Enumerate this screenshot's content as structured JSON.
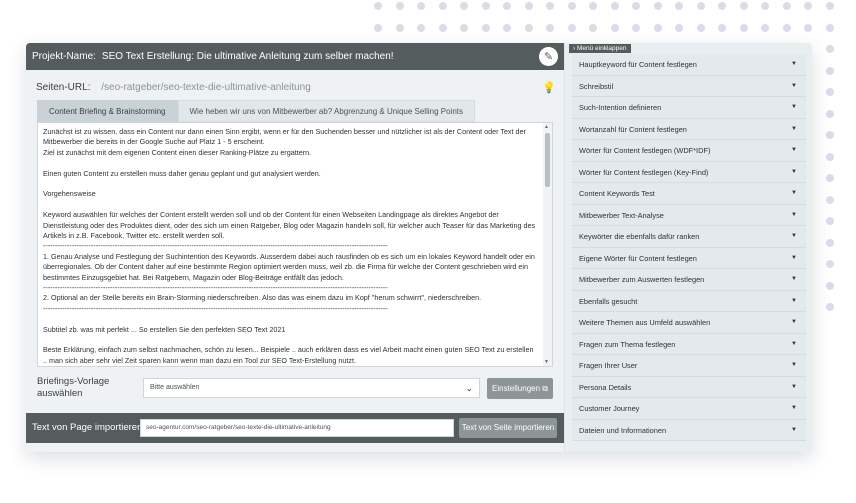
{
  "project": {
    "label": "Projekt-Name:",
    "name": "SEO Text Erstellung: Die ultimative Anleitung zum selber machen!",
    "edit_icon": "pencil-icon"
  },
  "url": {
    "label": "Seiten-URL:",
    "value": "/seo-ratgeber/seo-texte-die-ultimative-anleitung",
    "hint_icon": "lightbulb-icon"
  },
  "tabs": [
    {
      "label": "Content Briefing & Brainstorming",
      "active": true
    },
    {
      "label": "Wie heben wir uns von Mitbewerber ab? Abgrenzung & Unique Selling Points",
      "active": false
    }
  ],
  "editor": {
    "paragraphs": [
      "Zunächst ist zu wissen, dass ein Content nur dann einen Sinn ergibt, wenn er für den Suchenden besser und nützlicher ist  als der Content oder Text der Mitbewerber die bereits in der Google Suche auf Platz 1 - 5 erscheint.",
      "Ziel ist zunächst mit dem eigenen Content einen dieser Ranking-Plätze zu ergattern.",
      "Einen guten Content zu erstellen muss daher genau geplant und gut analysiert werden.",
      "Vorgehensweise",
      "Keyword auswählen für welches der Content erstellt werden soll und ob der Content für einen Webseiten Landingpage als direktes Angebot der Dienstleistung oder des Produktes dient, oder des sich um einen Ratgeber, Blog oder Magazin handeln soll,  für welcher auch Teaser für das Marketing des Artikels in z.B. Facebook, Twitter etc. erstellt werden soll.",
      "------------------------------------------------------------------------------------------------------------------------------------------------",
      "1. Genau Analyse und Festlegung der Suchintention des Keywords. Ausserdem dabei auch rausfinden ob es sich um ein lokales Keyword handelt oder ein überregionales. Ob der Content daher auf eine bestimmte Region optimiert werden muss, weil zb. die Firma für welche der Content geschrieben wird ein bestimmtes Einzugsgebiet hat. Bei Ratgebern, Magazin oder Blog-Beiträge entfällt das jedoch.",
      "------------------------------------------------------------------------------------------------------------------------------------------------",
      "2. Optional an der Stelle bereits ein Brain-Storming niederschreiben. Also das was einem dazu im Kopf \"herum schwirrt\", niederschreiben.",
      "------------------------------------------------------------------------------------------------------------------------------------------------",
      "Subtitel zb. was mit perfekt ...  So erstellen Sie den perfekten SEO Text 2021",
      "Beste Erklärung, einfach zum selbst nachmachen, schön zu lesen... Beispiele .. auch erklären dass es viel Arbeit macht einen guten SEO Text zu erstellen .. man sich aber sehr viel Zeit sparen kann wenn man dazu ein Tool zur SEO Text-Erstellung nutzt."
    ]
  },
  "briefing": {
    "label": "Briefings-Vorlage auswählen",
    "select_value": "Bitte auswählen",
    "settings_button": "Einstellungen"
  },
  "import": {
    "label": "Text von Page importieren",
    "input_value": "seo-agentur.com/seo-ratgeber/seo-texte-die-ultimative-anleitung",
    "button": "Text von Seite importieren"
  },
  "sidebar": {
    "collapse_label": "Menü einklappen",
    "items": [
      "Hauptkeyword für Content festlegen",
      "Schreibstil",
      "Such-Intention definieren",
      "Wortanzahl für Content festlegen",
      "Wörter für Content festlegen (WDF*IDF)",
      "Wörter für Content festlegen (Key-Find)",
      "Content Keywords Test",
      "Mitbewerber Text-Analyse",
      "Keywörter die ebenfalls dafür ranken",
      "Eigene Wörter für Content festlegen",
      "Mitbewerber zum Auswerten festlegen",
      "Ebenfalls gesucht",
      "Weitere Themen aus Umfeld auswählen",
      "Fragen zum Thema festlegen",
      "Fragen Ihrer User",
      "Persona Details",
      "Customer Journey",
      "Dateien und Informationen"
    ]
  },
  "colors": {
    "dark_bar": "#545c5e",
    "button_gray": "#8d9597",
    "panel_bg": "#eef2f5",
    "dots": "#d9dde7"
  }
}
